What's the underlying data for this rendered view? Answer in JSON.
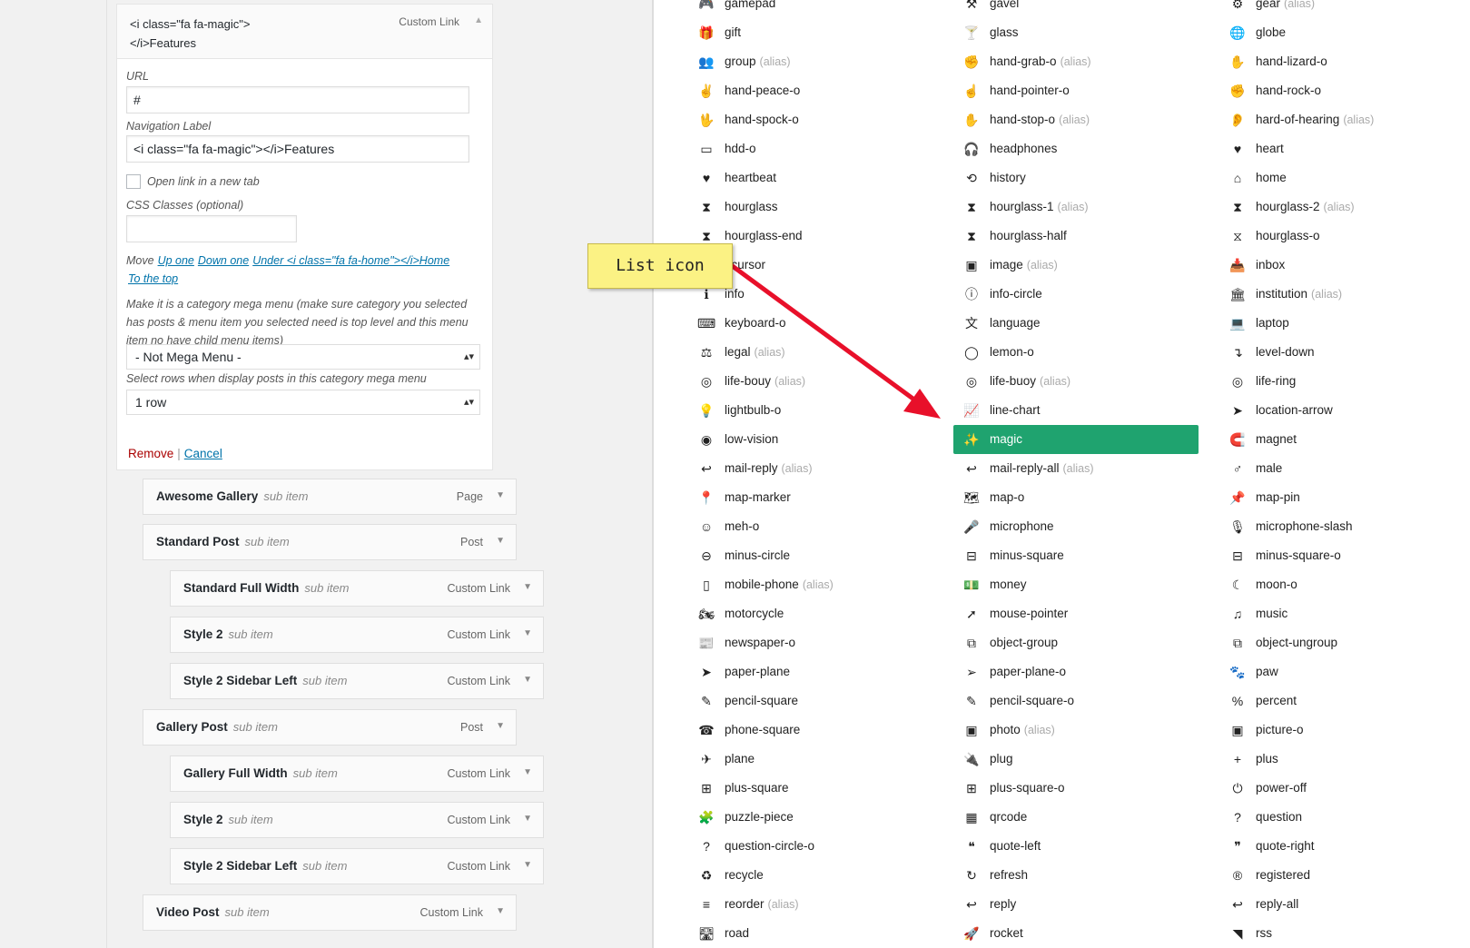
{
  "menu_card": {
    "title": "<i class=\"fa fa-magic\"></i>Features",
    "type": "Custom Link",
    "toggle_icon": "caret-up-icon",
    "url_label": "URL",
    "url_value": "#",
    "nav_label": "Navigation Label",
    "nav_value": "<i class=\"fa fa-magic\"></i>Features",
    "new_tab_label": "Open link in a new tab",
    "css_label": "CSS Classes (optional)",
    "css_value": "",
    "move_label": "Move",
    "move_links": [
      "Up one",
      "Down one",
      "Under <i class=\"fa fa-home\"></i>Home",
      "To the top"
    ],
    "mega_help": "Make it is a category mega menu (make sure category you selected has posts & menu item you selected need is top level and this menu item no have child menu items)",
    "mega_value": "- Not Mega Menu -",
    "rows_label": "Select rows when display posts in this category mega menu",
    "rows_value": "1 row",
    "remove_label": "Remove",
    "separator": "|",
    "cancel_label": "Cancel"
  },
  "sub_items": [
    {
      "title": "Awesome Gallery",
      "sub": "sub item",
      "type": "Page"
    },
    {
      "title": "Standard Post",
      "sub": "sub item",
      "type": "Post"
    },
    {
      "title": "Standard Full Width",
      "sub": "sub item",
      "type": "Custom Link"
    },
    {
      "title": "Style 2",
      "sub": "sub item",
      "type": "Custom Link"
    },
    {
      "title": "Style 2 Sidebar Left",
      "sub": "sub item",
      "type": "Custom Link"
    },
    {
      "title": "Gallery Post",
      "sub": "sub item",
      "type": "Post"
    },
    {
      "title": "Gallery Full Width",
      "sub": "sub item",
      "type": "Custom Link"
    },
    {
      "title": "Style 2",
      "sub": "sub item",
      "type": "Custom Link"
    },
    {
      "title": "Style 2 Sidebar Left",
      "sub": "sub item",
      "type": "Custom Link"
    },
    {
      "title": "Video Post",
      "sub": "sub item",
      "type": "Custom Link"
    }
  ],
  "annotation": {
    "text": "List icon"
  },
  "icon_columns": [
    [
      {
        "name": "gamepad",
        "glyph": "🎮"
      },
      {
        "name": "gift",
        "glyph": "🎁"
      },
      {
        "name": "group",
        "alias": "(alias)",
        "glyph": "👥"
      },
      {
        "name": "hand-peace-o",
        "glyph": "✌"
      },
      {
        "name": "hand-spock-o",
        "glyph": "🖖"
      },
      {
        "name": "hdd-o",
        "glyph": "▭"
      },
      {
        "name": "heartbeat",
        "glyph": "♥"
      },
      {
        "name": "hourglass",
        "glyph": "⧗"
      },
      {
        "name": "hourglass-end",
        "glyph": "⧗"
      },
      {
        "name": "i-cursor",
        "glyph": "I"
      },
      {
        "name": "info",
        "glyph": "ℹ"
      },
      {
        "name": "keyboard-o",
        "glyph": "⌨"
      },
      {
        "name": "legal",
        "alias": "(alias)",
        "glyph": "⚖"
      },
      {
        "name": "life-bouy",
        "alias": "(alias)",
        "glyph": "◎"
      },
      {
        "name": "lightbulb-o",
        "glyph": "💡"
      },
      {
        "name": "low-vision",
        "glyph": "◉"
      },
      {
        "name": "mail-reply",
        "alias": "(alias)",
        "glyph": "↩"
      },
      {
        "name": "map-marker",
        "glyph": "📍"
      },
      {
        "name": "meh-o",
        "glyph": "☺"
      },
      {
        "name": "minus-circle",
        "glyph": "⊖"
      },
      {
        "name": "mobile-phone",
        "alias": "(alias)",
        "glyph": "▯"
      },
      {
        "name": "motorcycle",
        "glyph": "🏍"
      },
      {
        "name": "newspaper-o",
        "glyph": "📰"
      },
      {
        "name": "paper-plane",
        "glyph": "➤"
      },
      {
        "name": "pencil-square",
        "glyph": "✎"
      },
      {
        "name": "phone-square",
        "glyph": "☎"
      },
      {
        "name": "plane",
        "glyph": "✈"
      },
      {
        "name": "plus-square",
        "glyph": "⊞"
      },
      {
        "name": "puzzle-piece",
        "glyph": "🧩"
      },
      {
        "name": "question-circle-o",
        "glyph": "?"
      },
      {
        "name": "recycle",
        "glyph": "♻"
      },
      {
        "name": "reorder",
        "alias": "(alias)",
        "glyph": "≡"
      },
      {
        "name": "road",
        "glyph": "🛣"
      }
    ],
    [
      {
        "name": "gavel",
        "glyph": "⚒"
      },
      {
        "name": "glass",
        "glyph": "🍸"
      },
      {
        "name": "hand-grab-o",
        "alias": "(alias)",
        "glyph": "✊"
      },
      {
        "name": "hand-pointer-o",
        "glyph": "☝"
      },
      {
        "name": "hand-stop-o",
        "alias": "(alias)",
        "glyph": "✋"
      },
      {
        "name": "headphones",
        "glyph": "🎧"
      },
      {
        "name": "history",
        "glyph": "⟲"
      },
      {
        "name": "hourglass-1",
        "alias": "(alias)",
        "glyph": "⧗"
      },
      {
        "name": "hourglass-half",
        "glyph": "⧗"
      },
      {
        "name": "image",
        "alias": "(alias)",
        "glyph": "▣"
      },
      {
        "name": "info-circle",
        "glyph": "ⓘ"
      },
      {
        "name": "language",
        "glyph": "文"
      },
      {
        "name": "lemon-o",
        "glyph": "◯"
      },
      {
        "name": "life-buoy",
        "alias": "(alias)",
        "glyph": "◎"
      },
      {
        "name": "line-chart",
        "glyph": "📈"
      },
      {
        "name": "magic",
        "glyph": "✨",
        "selected": true
      },
      {
        "name": "mail-reply-all",
        "alias": "(alias)",
        "glyph": "↩"
      },
      {
        "name": "map-o",
        "glyph": "🗺"
      },
      {
        "name": "microphone",
        "glyph": "🎤"
      },
      {
        "name": "minus-square",
        "glyph": "⊟"
      },
      {
        "name": "money",
        "glyph": "💵"
      },
      {
        "name": "mouse-pointer",
        "glyph": "➚"
      },
      {
        "name": "object-group",
        "glyph": "⧉"
      },
      {
        "name": "paper-plane-o",
        "glyph": "➢"
      },
      {
        "name": "pencil-square-o",
        "glyph": "✎"
      },
      {
        "name": "photo",
        "alias": "(alias)",
        "glyph": "▣"
      },
      {
        "name": "plug",
        "glyph": "🔌"
      },
      {
        "name": "plus-square-o",
        "glyph": "⊞"
      },
      {
        "name": "qrcode",
        "glyph": "▦"
      },
      {
        "name": "quote-left",
        "glyph": "❝"
      },
      {
        "name": "refresh",
        "glyph": "↻"
      },
      {
        "name": "reply",
        "glyph": "↩"
      },
      {
        "name": "rocket",
        "glyph": "🚀"
      }
    ],
    [
      {
        "name": "gear",
        "alias": "(alias)",
        "glyph": "⚙"
      },
      {
        "name": "globe",
        "glyph": "🌐"
      },
      {
        "name": "hand-lizard-o",
        "glyph": "✋"
      },
      {
        "name": "hand-rock-o",
        "glyph": "✊"
      },
      {
        "name": "hard-of-hearing",
        "alias": "(alias)",
        "glyph": "👂"
      },
      {
        "name": "heart",
        "glyph": "♥"
      },
      {
        "name": "home",
        "glyph": "⌂"
      },
      {
        "name": "hourglass-2",
        "alias": "(alias)",
        "glyph": "⧗"
      },
      {
        "name": "hourglass-o",
        "glyph": "⧖"
      },
      {
        "name": "inbox",
        "glyph": "📥"
      },
      {
        "name": "institution",
        "alias": "(alias)",
        "glyph": "🏛"
      },
      {
        "name": "laptop",
        "glyph": "💻"
      },
      {
        "name": "level-down",
        "glyph": "↴"
      },
      {
        "name": "life-ring",
        "glyph": "◎"
      },
      {
        "name": "location-arrow",
        "glyph": "➤"
      },
      {
        "name": "magnet",
        "glyph": "🧲"
      },
      {
        "name": "male",
        "glyph": "♂"
      },
      {
        "name": "map-pin",
        "glyph": "📌"
      },
      {
        "name": "microphone-slash",
        "glyph": "🎙"
      },
      {
        "name": "minus-square-o",
        "glyph": "⊟"
      },
      {
        "name": "moon-o",
        "glyph": "☾"
      },
      {
        "name": "music",
        "glyph": "♫"
      },
      {
        "name": "object-ungroup",
        "glyph": "⧉"
      },
      {
        "name": "paw",
        "glyph": "🐾"
      },
      {
        "name": "percent",
        "glyph": "%"
      },
      {
        "name": "picture-o",
        "glyph": "▣"
      },
      {
        "name": "plus",
        "glyph": "+"
      },
      {
        "name": "power-off",
        "glyph": "⏻"
      },
      {
        "name": "question",
        "glyph": "?"
      },
      {
        "name": "quote-right",
        "glyph": "❞"
      },
      {
        "name": "registered",
        "glyph": "®"
      },
      {
        "name": "reply-all",
        "glyph": "↩"
      },
      {
        "name": "rss",
        "glyph": "◥"
      }
    ]
  ]
}
